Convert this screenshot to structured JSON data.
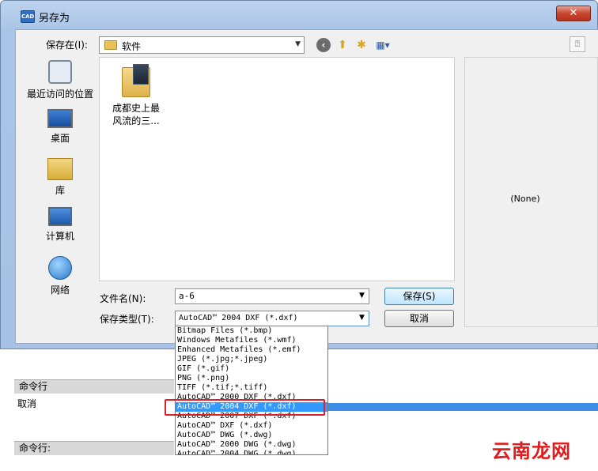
{
  "window": {
    "app_icon": "CAD",
    "title": "另存为",
    "close_label": "✕",
    "help_icon": "help-icon"
  },
  "toolbar": {
    "save_in_label": "保存在(I):",
    "location_value": "软件",
    "icons": [
      "back-icon",
      "up-folder-icon",
      "new-folder-icon",
      "views-menu-icon"
    ]
  },
  "places": [
    {
      "label": "最近访问的位置",
      "icon": "recent-places-icon"
    },
    {
      "label": "桌面",
      "icon": "desktop-icon"
    },
    {
      "label": "库",
      "icon": "library-icon"
    },
    {
      "label": "计算机",
      "icon": "computer-icon"
    },
    {
      "label": "网络",
      "icon": "network-icon"
    }
  ],
  "files": [
    {
      "name_line1": "成都史上最",
      "name_line2": "风流的三...",
      "icon": "folder-icon"
    }
  ],
  "preview": {
    "text": "(None)"
  },
  "form": {
    "filename_label": "文件名(N):",
    "filename_value": "a-6",
    "filetype_label": "保存类型(T):",
    "filetype_value": "AutoCAD™ 2004 DXF (*.dxf)",
    "save_label": "保存(S)",
    "cancel_label": "取消"
  },
  "filetype_options": [
    "Bitmap Files (*.bmp)",
    "Windows Metafiles (*.wmf)",
    "Enhanced Metafiles (*.emf)",
    "JPEG (*.jpg;*.jpeg)",
    "GIF (*.gif)",
    "PNG (*.png)",
    "TIFF (*.tif;*.tiff)",
    "AutoCAD™ 2000 DXF (*.dxf)",
    "AutoCAD™ 2004 DXF (*.dxf)",
    "AutoCAD™ 2007 DXF (*.dxf)",
    "AutoCAD™ DXF (*.dxf)",
    "AutoCAD™ DWG (*.dwg)",
    "AutoCAD™ 2000 DWG (*.dwg)",
    "AutoCAD™ 2004 DWG (*.dwg)"
  ],
  "selected_option_index": 8,
  "command_area": {
    "header1": "命令行",
    "cancel_text": "取消",
    "header2": "命令行:"
  },
  "watermark": "云南龙网",
  "colors": {
    "selection": "#3399ff",
    "highlight_box": "#d9232a",
    "watermark": "#e01b1b"
  }
}
